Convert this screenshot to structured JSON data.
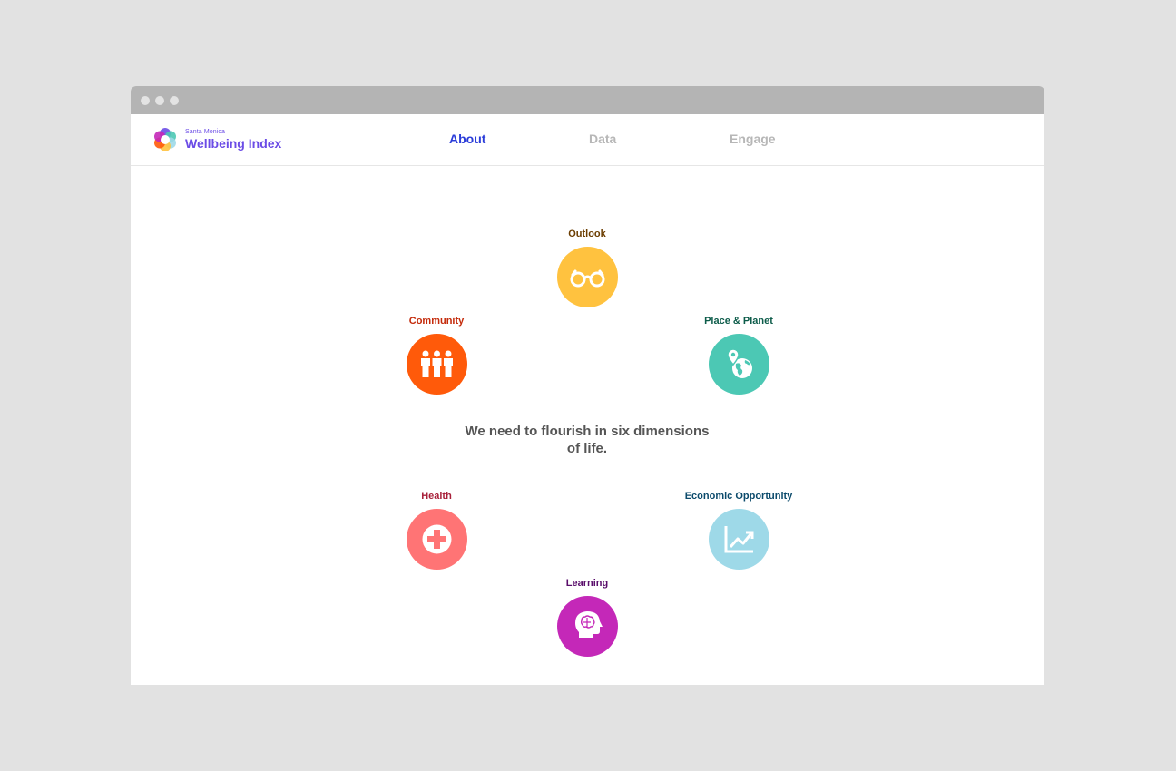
{
  "brand": {
    "small": "Santa Monica",
    "name": "Wellbeing Index"
  },
  "nav": [
    {
      "label": "About",
      "active": true
    },
    {
      "label": "Data",
      "active": false
    },
    {
      "label": "Engage",
      "active": false
    }
  ],
  "dimensions": {
    "outlook": {
      "label": "Outlook",
      "color": "#ffc23f",
      "label_color": "#6b3d00",
      "icon": "binoculars-icon"
    },
    "community": {
      "label": "Community",
      "color": "#ff5a0a",
      "label_color": "#c42a0a",
      "icon": "people-icon"
    },
    "place_planet": {
      "label": "Place & Planet",
      "color": "#4cc8b4",
      "label_color": "#0d5c4a",
      "icon": "globe-pin-icon"
    },
    "health": {
      "label": "Health",
      "color": "#ff7475",
      "label_color": "#a8203a",
      "icon": "medical-cross-icon"
    },
    "economic": {
      "label": "Economic Opportunity",
      "color": "#9ed9e8",
      "label_color": "#0b4a6b",
      "icon": "trend-chart-icon"
    },
    "learning": {
      "label": "Learning",
      "color": "#c428b8",
      "label_color": "#5a0e6b",
      "icon": "brain-head-icon"
    }
  },
  "center_text": {
    "line1": "We need to flourish in six dimensions",
    "line2": "of life."
  }
}
